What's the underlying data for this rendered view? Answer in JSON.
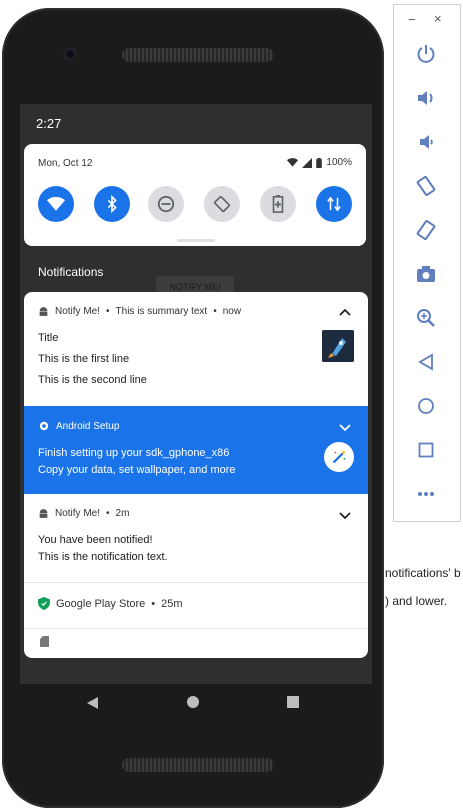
{
  "background": {
    "fragments": [
      "notifications' b",
      ") and lower."
    ]
  },
  "status_bar": {
    "time": "2:27"
  },
  "quick_settings": {
    "date": "Mon, Oct 12",
    "battery": "100%",
    "tiles": [
      {
        "name": "wifi",
        "state": "on"
      },
      {
        "name": "bluetooth",
        "state": "on"
      },
      {
        "name": "do-not-disturb",
        "state": "off"
      },
      {
        "name": "auto-rotate",
        "state": "off"
      },
      {
        "name": "battery-saver",
        "state": "off"
      },
      {
        "name": "mobile-data",
        "state": "on"
      }
    ]
  },
  "notifications_header": "Notifications",
  "behind_button": "NOTIFY ME!",
  "notifications": [
    {
      "app": "Notify Me!",
      "summary": "This is summary text",
      "time": "now",
      "title": "Title",
      "lines": [
        "This is the first line",
        "This is the second line"
      ],
      "icon": "android-icon",
      "thumbnail": "rocket-image"
    },
    {
      "app": "Android Setup",
      "title": "Finish setting up your sdk_gphone_x86",
      "text": "Copy your data, set wallpaper, and more",
      "icon": "gear-icon",
      "accent": "#1a73e8"
    },
    {
      "app": "Notify Me!",
      "time": "2m",
      "lines": [
        "You have been notified!",
        "This is the notification text."
      ],
      "icon": "android-icon"
    },
    {
      "app": "Google Play Store",
      "time": "25m",
      "icon": "play-protect-icon"
    }
  ],
  "emulator_panel": {
    "window_controls": [
      "−",
      "×"
    ],
    "buttons": [
      "power",
      "volume-up",
      "volume-down",
      "rotate-left",
      "rotate-right",
      "screenshot",
      "zoom",
      "back",
      "home",
      "overview",
      "more"
    ]
  },
  "colors": {
    "accent": "#1a73e8",
    "icon_blue": "#5f7fbf"
  }
}
